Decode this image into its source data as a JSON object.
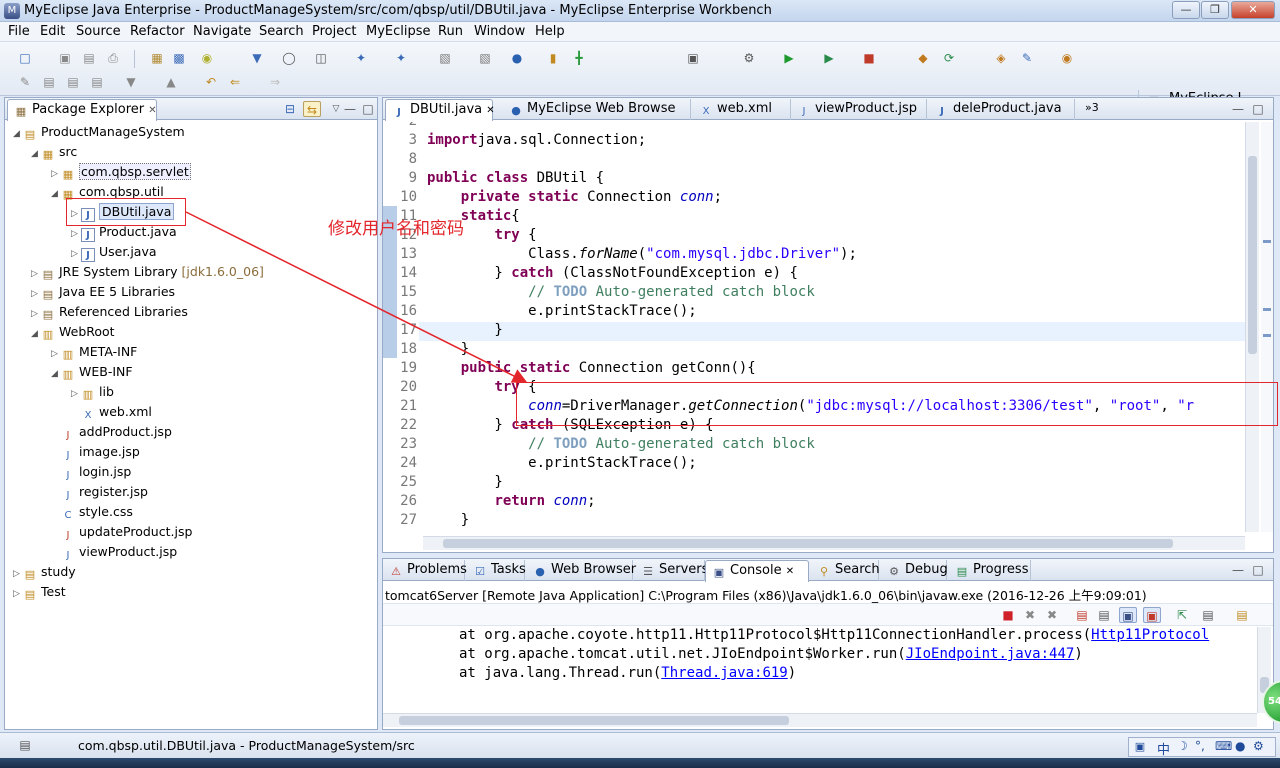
{
  "window": {
    "title": "MyEclipse Java Enterprise - ProductManageSystem/src/com/qbsp/util/DBUtil.java - MyEclipse Enterprise Workbench"
  },
  "menu": [
    "File",
    "Edit",
    "Source",
    "Refactor",
    "Navigate",
    "Search",
    "Project",
    "MyEclipse",
    "Run",
    "Window",
    "Help"
  ],
  "perspective": {
    "label": "MyEclipse I..."
  },
  "package_explorer": {
    "tab_label": "Package Explorer",
    "tree": [
      {
        "label": "ProductManageSystem"
      },
      {
        "label": "src"
      },
      {
        "label": "com.qbsp.servlet"
      },
      {
        "label": "com.qbsp.util"
      },
      {
        "label": "DBUtil.java"
      },
      {
        "label": "Product.java"
      },
      {
        "label": "User.java"
      },
      {
        "label": "JRE System Library",
        "suffix": "[jdk1.6.0_06]"
      },
      {
        "label": "Java EE 5 Libraries"
      },
      {
        "label": "Referenced Libraries"
      },
      {
        "label": "WebRoot"
      },
      {
        "label": "META-INF"
      },
      {
        "label": "WEB-INF"
      },
      {
        "label": "lib"
      },
      {
        "label": "web.xml"
      },
      {
        "label": "addProduct.jsp"
      },
      {
        "label": "image.jsp"
      },
      {
        "label": "login.jsp"
      },
      {
        "label": "register.jsp"
      },
      {
        "label": "style.css"
      },
      {
        "label": "updateProduct.jsp"
      },
      {
        "label": "viewProduct.jsp"
      },
      {
        "label": "study"
      },
      {
        "label": "Test"
      }
    ]
  },
  "editor": {
    "tabs": [
      {
        "label": "DBUtil.java"
      },
      {
        "label": "MyEclipse Web Browse"
      },
      {
        "label": "web.xml"
      },
      {
        "label": "viewProduct.jsp"
      },
      {
        "label": "deleProduct.java"
      },
      {
        "label": "»3"
      }
    ],
    "lines": [
      {
        "n": "2",
        "segs": []
      },
      {
        "n": "3",
        "segs": [
          [
            "kw",
            "import"
          ],
          [
            "",
            "java.sql.Connection;"
          ]
        ]
      },
      {
        "n": "8",
        "segs": []
      },
      {
        "n": "9",
        "segs": [
          [
            "kw",
            "public class"
          ],
          [
            "",
            " DBUtil {"
          ]
        ]
      },
      {
        "n": "10",
        "segs": [
          [
            "",
            "    "
          ],
          [
            "kw",
            "private static"
          ],
          [
            "",
            " Connection "
          ],
          [
            "fld",
            "conn"
          ],
          [
            "",
            ";"
          ]
        ]
      },
      {
        "n": "11",
        "segs": [
          [
            "",
            "    "
          ],
          [
            "kw",
            "static"
          ],
          [
            "",
            "{"
          ]
        ]
      },
      {
        "n": "12",
        "segs": [
          [
            "",
            "        "
          ],
          [
            "kw",
            "try"
          ],
          [
            "",
            " {"
          ]
        ]
      },
      {
        "n": "13",
        "segs": [
          [
            "",
            "            Class."
          ],
          [
            "it",
            "forName"
          ],
          [
            "",
            "("
          ],
          [
            "str",
            "\"com.mysql.jdbc.Driver\""
          ],
          [
            "",
            ");"
          ]
        ]
      },
      {
        "n": "14",
        "segs": [
          [
            "",
            "        } "
          ],
          [
            "kw",
            "catch"
          ],
          [
            "",
            " (ClassNotFoundException e) {"
          ]
        ]
      },
      {
        "n": "15",
        "segs": [
          [
            "",
            "            "
          ],
          [
            "cmt",
            "// "
          ],
          [
            "todo",
            "TODO"
          ],
          [
            "cmt",
            " Auto-generated catch block"
          ]
        ]
      },
      {
        "n": "16",
        "segs": [
          [
            "",
            "            e.printStackTrace();"
          ]
        ]
      },
      {
        "n": "17",
        "segs": [
          [
            "",
            "        }"
          ]
        ]
      },
      {
        "n": "18",
        "segs": [
          [
            "",
            "    }"
          ]
        ]
      },
      {
        "n": "19",
        "segs": [
          [
            "",
            "    "
          ],
          [
            "kw",
            "public static"
          ],
          [
            "",
            " Connection getConn(){"
          ]
        ]
      },
      {
        "n": "20",
        "segs": [
          [
            "",
            "        "
          ],
          [
            "kw",
            "try"
          ],
          [
            "",
            " {"
          ]
        ]
      },
      {
        "n": "21",
        "segs": [
          [
            "",
            "            "
          ],
          [
            "fld",
            "conn"
          ],
          [
            "",
            "=DriverManager."
          ],
          [
            "it",
            "getConnection"
          ],
          [
            "",
            "("
          ],
          [
            "str",
            "\"jdbc:mysql://localhost:3306/test\""
          ],
          [
            "",
            ", "
          ],
          [
            "str",
            "\"root\""
          ],
          [
            "",
            ", "
          ],
          [
            "str",
            "\"r"
          ]
        ]
      },
      {
        "n": "22",
        "segs": [
          [
            "",
            "        } "
          ],
          [
            "kw",
            "catch"
          ],
          [
            "",
            " (SQLException e) {"
          ]
        ]
      },
      {
        "n": "23",
        "segs": [
          [
            "",
            "            "
          ],
          [
            "cmt",
            "// "
          ],
          [
            "todo",
            "TODO"
          ],
          [
            "cmt",
            " Auto-generated catch block"
          ]
        ]
      },
      {
        "n": "24",
        "segs": [
          [
            "",
            "            e.printStackTrace();"
          ]
        ]
      },
      {
        "n": "25",
        "segs": [
          [
            "",
            "        }"
          ]
        ]
      },
      {
        "n": "26",
        "segs": [
          [
            "",
            "        "
          ],
          [
            "kw",
            "return"
          ],
          [
            "",
            " "
          ],
          [
            "fld",
            "conn"
          ],
          [
            "",
            ";"
          ]
        ]
      },
      {
        "n": "27",
        "segs": [
          [
            "",
            "    }"
          ]
        ]
      }
    ]
  },
  "annotation": {
    "text": "修改用户名和密码"
  },
  "console": {
    "tabs": [
      {
        "label": "Problems"
      },
      {
        "label": "Tasks"
      },
      {
        "label": "Web Browser"
      },
      {
        "label": "Servers"
      },
      {
        "label": "Console"
      },
      {
        "label": "Search"
      },
      {
        "label": "Debug"
      },
      {
        "label": "Progress"
      }
    ],
    "header": "tomcat6Server [Remote Java Application] C:\\Program Files (x86)\\Java\\jdk1.6.0_06\\bin\\javaw.exe (2016-12-26 上午9:09:01)",
    "lines": [
      {
        "pre": "at org.apache.coyote.http11.Http11Protocol$Http11ConnectionHandler.process(",
        "link": "Http11Protocol",
        "post": ""
      },
      {
        "pre": "at org.apache.tomcat.util.net.JIoEndpoint$Worker.run(",
        "link": "JIoEndpoint.java:447",
        "post": ")"
      },
      {
        "pre": "at java.lang.Thread.run(",
        "link": "Thread.java:619",
        "post": ")"
      }
    ]
  },
  "status_bar": {
    "text": "com.qbsp.util.DBUtil.java - ProductManageSystem/src",
    "badge": "54"
  },
  "ime": {
    "label": "中"
  }
}
